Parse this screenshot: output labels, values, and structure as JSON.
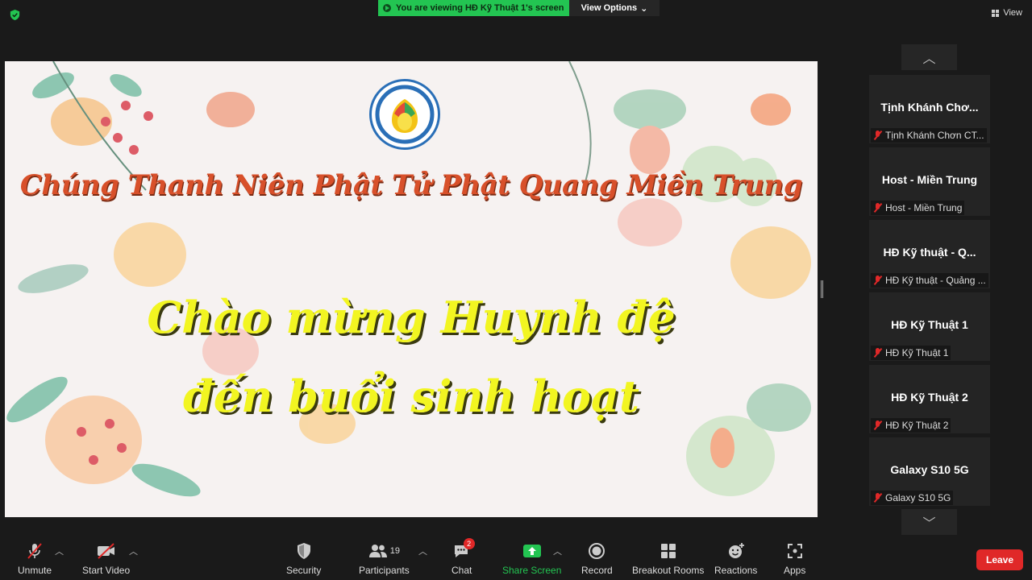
{
  "top": {
    "viewing_banner": "You are viewing HĐ Kỹ Thuật 1's screen",
    "view_options": "View Options",
    "view_button": "View"
  },
  "shared_screen": {
    "title_line": "Chúng Thanh Niên Phật Tử Phật Quang Miền Trung",
    "welcome_line_1": "Chào mừng Huynh đệ",
    "welcome_line_2": "đến buổi sinh hoạt",
    "colors": {
      "title": "#d8502a",
      "welcome": "#f2f521",
      "background": "#f6f2f1"
    }
  },
  "participants": [
    {
      "name": "Tịnh Khánh Chơ...",
      "label": "Tịnh Khánh Chơn CT..."
    },
    {
      "name": "Host - Miền Trung",
      "label": "Host - Miền Trung"
    },
    {
      "name": "HĐ Kỹ thuật - Q...",
      "label": "HĐ Kỹ thuật - Quảng ..."
    },
    {
      "name": "HĐ Kỹ Thuật 1",
      "label": "HĐ Kỹ Thuật 1"
    },
    {
      "name": "HĐ Kỹ Thuật 2",
      "label": "HĐ Kỹ Thuật 2"
    },
    {
      "name": "Galaxy S10 5G",
      "label": "Galaxy S10 5G"
    }
  ],
  "toolbar": {
    "unmute": "Unmute",
    "start_video": "Start Video",
    "security": "Security",
    "participants": "Participants",
    "participants_count": "19",
    "chat": "Chat",
    "chat_badge": "2",
    "share_screen": "Share Screen",
    "record": "Record",
    "breakout_rooms": "Breakout Rooms",
    "reactions": "Reactions",
    "apps": "Apps",
    "leave": "Leave"
  },
  "colors": {
    "accent_green": "#23c552",
    "leave_red": "#e02828",
    "bg": "#1a1a1a"
  }
}
